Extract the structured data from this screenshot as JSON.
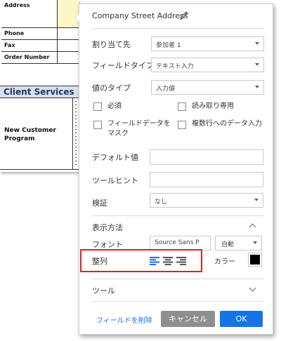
{
  "document": {
    "rows": {
      "address": "Address",
      "phone": "Phone",
      "fax": "Fax",
      "order_number": "Order Number"
    },
    "section_title": "Client Services",
    "program_label": "New Customer Program",
    "highlight_color": "#fdf7c8"
  },
  "panel": {
    "field_name": "Company Street Address",
    "assign_to": {
      "label": "割り当て先",
      "value": "参加者 1"
    },
    "field_type": {
      "label": "フィールドタイプ",
      "value": "テキスト入力"
    },
    "value_type": {
      "label": "値のタイプ",
      "value": "入力値"
    },
    "checkboxes": {
      "required": "必須",
      "read_only": "読み取り専用",
      "mask": "フィールドデータをマスク",
      "multiline": "複数行へのデータ入力"
    },
    "default_value": {
      "label": "デフォルト値",
      "value": ""
    },
    "tooltip": {
      "label": "ツールヒント",
      "value": ""
    },
    "validation": {
      "label": "検証",
      "value": "なし"
    },
    "display": {
      "header": "表示方法",
      "font_label": "フォント",
      "font_value": "Source Sans P",
      "size_value": "自動",
      "align_label": "整列",
      "color_label": "カラー",
      "color_value": "#000000"
    },
    "tools": {
      "header": "ツール"
    },
    "footer": {
      "delete": "フィールドを削除",
      "cancel": "キャンセル",
      "ok": "OK"
    },
    "colors": {
      "primary": "#1473e6",
      "cancel": "#8e8e8e",
      "highlight_box": "#e02020"
    },
    "icons": [
      "pencil-icon",
      "chevron-up-icon",
      "chevron-down-icon",
      "align-left-icon",
      "align-center-icon",
      "align-right-icon"
    ]
  }
}
